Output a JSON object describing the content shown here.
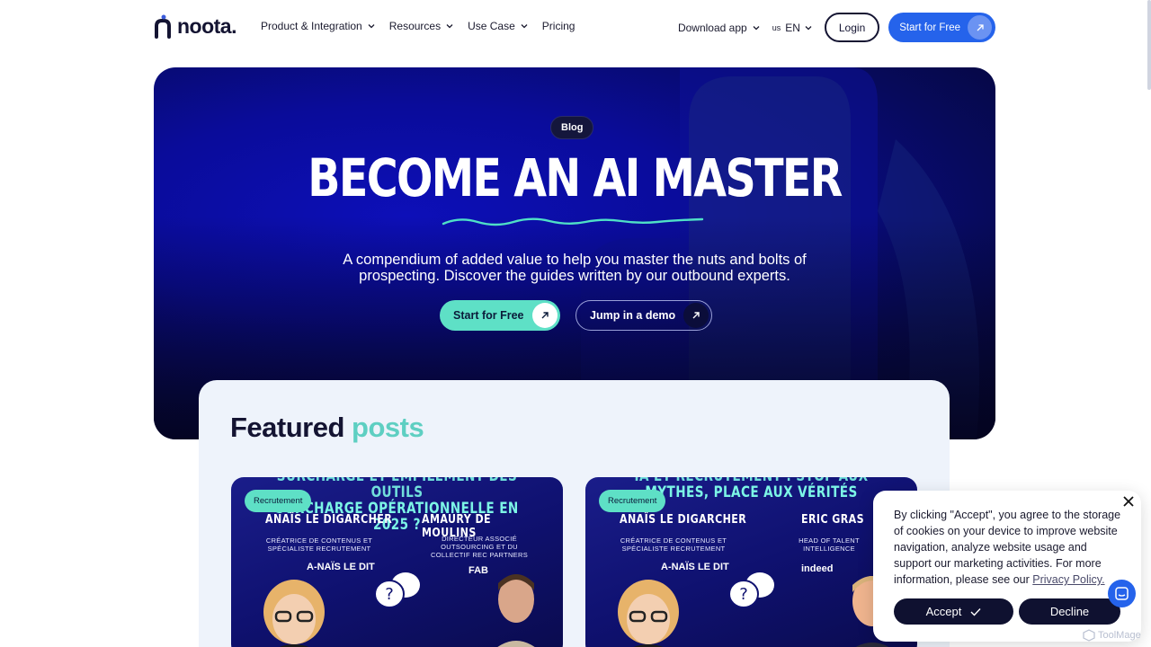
{
  "nav": {
    "logo_text": "noota.",
    "links": [
      {
        "label": "Product & Integration",
        "has_dropdown": true
      },
      {
        "label": "Resources",
        "has_dropdown": true
      },
      {
        "label": "Use Case",
        "has_dropdown": true
      },
      {
        "label": "Pricing",
        "has_dropdown": false
      }
    ],
    "download_label": "Download app",
    "lang_flag": "us",
    "lang_code": "EN",
    "login_label": "Login",
    "cta_label": "Start for Free"
  },
  "hero": {
    "pill": "Blog",
    "title": "BECOME AN AI MASTER",
    "subtitle": "A compendium of added value to help you master the nuts and bolts of prospecting. Discover the guides written by our outbound experts.",
    "primary_cta": "Start for Free",
    "secondary_cta": "Jump in a demo"
  },
  "featured": {
    "title_part1": "Featured",
    "title_part2": "posts",
    "cards": [
      {
        "tag": "Recrutement",
        "header_top": "SURCHARGE ET EMPILEMENT DES OUTILS",
        "header": "SURCHARGE OPÉRATIONNELLE EN 2025 ?",
        "person1_name": "ANAÏS LE DIGARCHER",
        "person1_role": "CRÉATRICE DE CONTENUS ET SPÉCIALISTE RECRUTEMENT",
        "person1_brand": "A-NAÏS LE DIT",
        "person2_name": "AMAURY DE MOULINS",
        "person2_role": "DIRECTEUR ASSOCIÉ OUTSOURCING ET DU COLLECTIF REC PARTNERS",
        "person2_brand": "FAB"
      },
      {
        "tag": "Recrutement",
        "header_top": "IA ET RECRUTEMENT : STOP AUX",
        "header": "MYTHES, PLACE AUX VÉRITÉS",
        "person1_name": "ANAÏS LE DIGARCHER",
        "person1_role": "CRÉATRICE DE CONTENUS ET SPÉCIALISTE RECRUTEMENT",
        "person1_brand": "A-NAÏS LE DIT",
        "person2_name": "ERIC GRAS",
        "person2_role": "HEAD OF TALENT INTELLIGENCE",
        "person2_brand": "indeed"
      }
    ]
  },
  "cookie": {
    "text": "By clicking \"Accept\", you agree to the storage of cookies on your device to improve website navigation, analyze website usage and support our marketing activities. For more information, please see our",
    "policy_link": "Privacy Policy.",
    "accept_label": "Accept",
    "decline_label": "Decline"
  },
  "watermark": "ToolMage",
  "colors": {
    "brand_blue": "#2563eb",
    "teal": "#5ee0c6",
    "navy": "#141432"
  }
}
